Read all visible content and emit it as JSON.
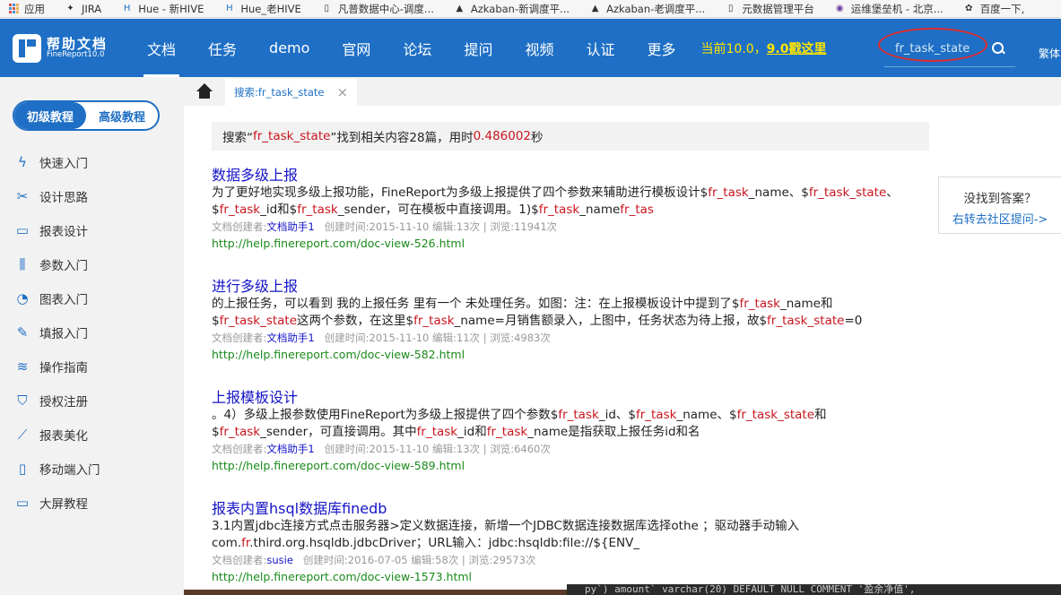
{
  "bookmarks": [
    {
      "label": "应用",
      "icon": "apps-grid-icon"
    },
    {
      "label": "JIRA",
      "icon": "jira-icon"
    },
    {
      "label": "Hue - 新HIVE",
      "icon": "hue-icon"
    },
    {
      "label": "Hue_老HIVE",
      "icon": "hue-icon"
    },
    {
      "label": "凡普数据中心-调度...",
      "icon": "page-icon"
    },
    {
      "label": "Azkaban-新调度平...",
      "icon": "azkaban-icon"
    },
    {
      "label": "Azkaban-老调度平...",
      "icon": "azkaban-icon"
    },
    {
      "label": "元数据管理平台",
      "icon": "page-icon"
    },
    {
      "label": "运维堡垒机 - 北京...",
      "icon": "bastion-icon"
    },
    {
      "label": "百度一下,",
      "icon": "baidu-paw-icon"
    }
  ],
  "header": {
    "logo_title": "帮助文档",
    "logo_sub": "FineReport10.0",
    "nav": [
      "文档",
      "任务",
      "demo",
      "官网",
      "论坛",
      "提问",
      "视频",
      "认证",
      "更多"
    ],
    "active_nav": "文档",
    "promo_prefix": "当前10.0，",
    "promo_link": "9.0戳这里",
    "search_value": "fr_task_state",
    "lang": "繁体"
  },
  "sidebar": {
    "level_basic": "初级教程",
    "level_advanced": "高级教程",
    "items": [
      {
        "label": "快速入门",
        "icon": "lightning-icon"
      },
      {
        "label": "设计思路",
        "icon": "tools-icon"
      },
      {
        "label": "报表设计",
        "icon": "report-chart-icon"
      },
      {
        "label": "参数入门",
        "icon": "sliders-icon"
      },
      {
        "label": "图表入门",
        "icon": "pie-chart-icon"
      },
      {
        "label": "填报入门",
        "icon": "edit-icon"
      },
      {
        "label": "操作指南",
        "icon": "guide-icon"
      },
      {
        "label": "授权注册",
        "icon": "shield-icon"
      },
      {
        "label": "报表美化",
        "icon": "line-chart-icon"
      },
      {
        "label": "移动端入门",
        "icon": "mobile-icon"
      },
      {
        "label": "大屏教程",
        "icon": "monitor-icon"
      }
    ]
  },
  "tabs": {
    "active_tab": "搜索:fr_task_state",
    "close": "×"
  },
  "search_summary": {
    "prefix": "搜索“",
    "keyword": "fr_task_state",
    "middle": "”找到相关内容28篇，用时 ",
    "time": "0.486002",
    "suffix": " 秒"
  },
  "results": [
    {
      "title": "数据多级上报",
      "snippet_line1": [
        {
          "t": "为了更好地实现多级上报功能，FineReport为多级上报提供了四个参数来辅助进行模板设计$",
          "h": false
        },
        {
          "t": "fr_task",
          "h": true
        },
        {
          "t": "_name、$",
          "h": false
        },
        {
          "t": "fr_task_state",
          "h": true
        },
        {
          "t": "、",
          "h": false
        }
      ],
      "snippet_line2": [
        {
          "t": "$",
          "h": false
        },
        {
          "t": "fr_task",
          "h": true
        },
        {
          "t": "_id和$",
          "h": false
        },
        {
          "t": "fr_task",
          "h": true
        },
        {
          "t": "_sender，可在模板中直接调用。1)$",
          "h": false
        },
        {
          "t": "fr_task",
          "h": true
        },
        {
          "t": "_name",
          "h": false
        },
        {
          "t": "fr_tas",
          "h": true
        }
      ],
      "creator_label": "文档创建者:",
      "creator": "文档助手1",
      "meta": "创建时间:2015-11-10 编辑:13次 | 浏览:11941次",
      "url": "http://help.finereport.com/doc-view-526.html"
    },
    {
      "title": "进行多级上报",
      "snippet_line1": [
        {
          "t": "的上报任务，可以看到 我的上报任务 里有一个 未处理任务。如图：注：在上报模板设计中提到了$",
          "h": false
        },
        {
          "t": "fr_task",
          "h": true
        },
        {
          "t": "_name和",
          "h": false
        }
      ],
      "snippet_line2": [
        {
          "t": "$",
          "h": false
        },
        {
          "t": "fr_task_state",
          "h": true
        },
        {
          "t": "这两个参数，在这里$",
          "h": false
        },
        {
          "t": "fr_task",
          "h": true
        },
        {
          "t": "_name=月销售额录入，上图中，任务状态为待上报，故$",
          "h": false
        },
        {
          "t": "fr_task_state",
          "h": true
        },
        {
          "t": "=0",
          "h": false
        }
      ],
      "creator_label": "文档创建者:",
      "creator": "文档助手1",
      "meta": "创建时间:2015-11-10 编辑:11次 | 浏览:4983次",
      "url": "http://help.finereport.com/doc-view-582.html"
    },
    {
      "title": "上报模板设计",
      "snippet_line1": [
        {
          "t": "。4）多级上报参数使用FineReport为多级上报提供了四个参数$",
          "h": false
        },
        {
          "t": "fr_task",
          "h": true
        },
        {
          "t": "_id、$",
          "h": false
        },
        {
          "t": "fr_task",
          "h": true
        },
        {
          "t": "_name、$",
          "h": false
        },
        {
          "t": "fr_task_state",
          "h": true
        },
        {
          "t": "和",
          "h": false
        }
      ],
      "snippet_line2": [
        {
          "t": "$",
          "h": false
        },
        {
          "t": "fr_task",
          "h": true
        },
        {
          "t": "_sender，可直接调用。其中",
          "h": false
        },
        {
          "t": "fr_task",
          "h": true
        },
        {
          "t": "_id和",
          "h": false
        },
        {
          "t": "fr_task",
          "h": true
        },
        {
          "t": "_name是指获取上报任务id和名",
          "h": false
        }
      ],
      "creator_label": "文档创建者:",
      "creator": "文档助手1",
      "meta": "创建时间:2015-11-10 编辑:13次 | 浏览:6460次",
      "url": "http://help.finereport.com/doc-view-589.html"
    },
    {
      "title": "报表内置hsql数据库finedb",
      "snippet_line1": [
        {
          "t": "3.1内置jdbc连接方式点击服务器>定义数据连接，新增一个JDBC数据连接数据库选择othe ；驱动器手动输入",
          "h": false
        }
      ],
      "snippet_line2": [
        {
          "t": "com.",
          "h": false
        },
        {
          "t": "fr",
          "h": true
        },
        {
          "t": ".third.org.hsqldb.jdbcDriver；URL输入：jdbc:hsqldb:file://${ENV_",
          "h": false
        }
      ],
      "creator_label": "文档创建者:",
      "creator": "susie",
      "meta": "创建时间:2016-07-05 编辑:58次 | 浏览:29573次",
      "url": "http://help.finereport.com/doc-view-1573.html"
    }
  ],
  "ask_box": {
    "question": "没找到答案？",
    "link": "右转去社区提问->"
  },
  "code_strip": "py`) amount` varchar(20) DEFAULT NULL COMMENT '盈余净值',",
  "colors": {
    "brand_blue": "#1e6fc5",
    "highlight_red": "#c9151e",
    "url_green": "#1a8a1a",
    "promo_yellow": "#ffe600",
    "annotation_red": "#e32a2a"
  }
}
